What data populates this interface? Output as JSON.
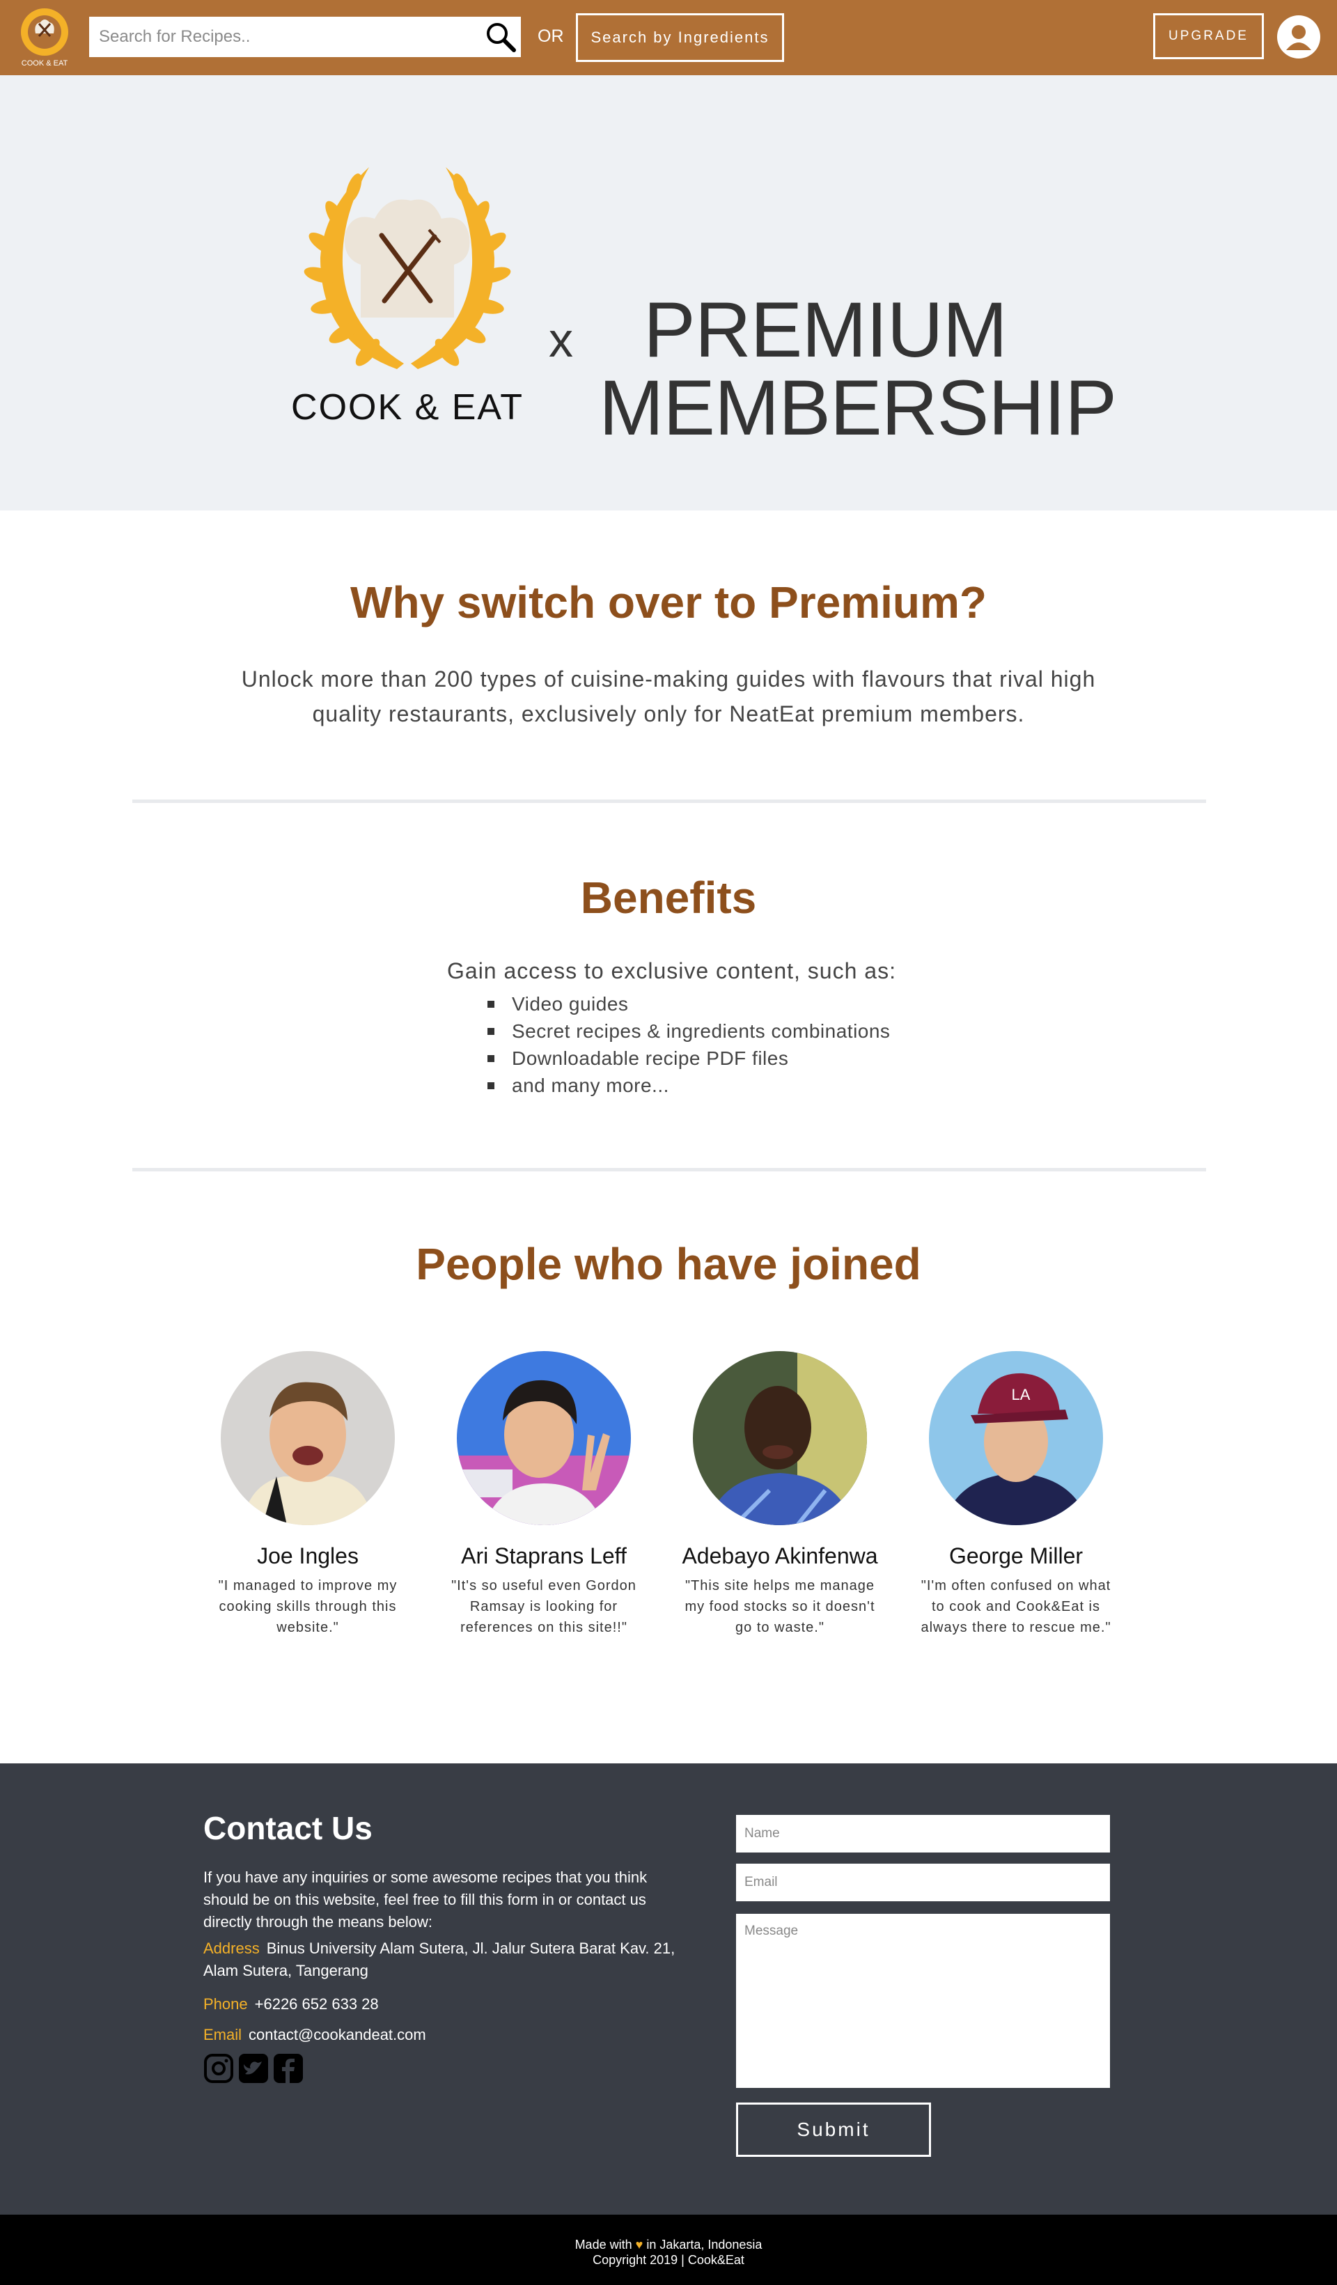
{
  "header": {
    "logo_text": "COOK & EAT",
    "search_placeholder": "Search for Recipes..",
    "or_label": "OR",
    "search_ingredients_label": "Search by Ingredients",
    "upgrade_label": "UPGRADE",
    "icons": {
      "search": "search-icon",
      "account": "user-avatar-icon"
    }
  },
  "hero": {
    "logo_text": "COOK & EAT",
    "x_label": "x",
    "title_line1": "PREMIUM",
    "title_line2": "MEMBERSHIP"
  },
  "why": {
    "title": "Why switch over to Premium?",
    "text": "Unlock more than 200 types of cuisine-making guides with flavours that rival high quality restaurants, exclusively only for NeatEat premium members."
  },
  "benefits": {
    "title": "Benefits",
    "intro": "Gain access to exclusive content, such as:",
    "items": [
      "Video guides",
      "Secret recipes & ingredients combinations",
      "Downloadable recipe PDF files",
      "and many more..."
    ]
  },
  "people": {
    "title": "People who have joined",
    "members": [
      {
        "name": "Joe Ingles",
        "quote": "\"I managed to improve my cooking skills through this website.\""
      },
      {
        "name": "Ari Staprans Leff",
        "quote": "\"It's so useful even Gordon Ramsay is looking for references on this site!!\""
      },
      {
        "name": "Adebayo Akinfenwa",
        "quote": "\"This site helps me manage my food stocks so it doesn't go to waste.\""
      },
      {
        "name": "George Miller",
        "quote": "\"I'm often confused on what to cook and Cook&Eat is always there to rescue me.\""
      }
    ]
  },
  "contact": {
    "title": "Contact Us",
    "text": "If you have any inquiries or some awesome recipes that you think should be on this website, feel free to fill this form in or contact us directly through the means below:",
    "address_label": "Address",
    "address": "Binus University Alam Sutera, Jl. Jalur Sutera Barat Kav. 21, Alam Sutera, Tangerang",
    "phone_label": "Phone",
    "phone": "+6226 652 633 28",
    "email_label": "Email",
    "email": "contact@cookandeat.com",
    "social_icons": [
      "instagram-icon",
      "twitter-icon",
      "facebook-icon"
    ],
    "form": {
      "name_placeholder": "Name",
      "email_placeholder": "Email",
      "message_placeholder": "Message",
      "submit_label": "Submit"
    }
  },
  "footer": {
    "made_with_pre": "Made with",
    "made_with_post": "in Jakarta, Indonesia",
    "copyright": "Copyright 2019 | Cook&Eat"
  },
  "colors": {
    "header_bg": "#b07036",
    "accent_brown": "#8d4f1c",
    "accent_gold": "#f4b128",
    "hero_bg": "#eef1f4",
    "contact_bg": "#393d45",
    "bottom_bg": "#000000"
  }
}
